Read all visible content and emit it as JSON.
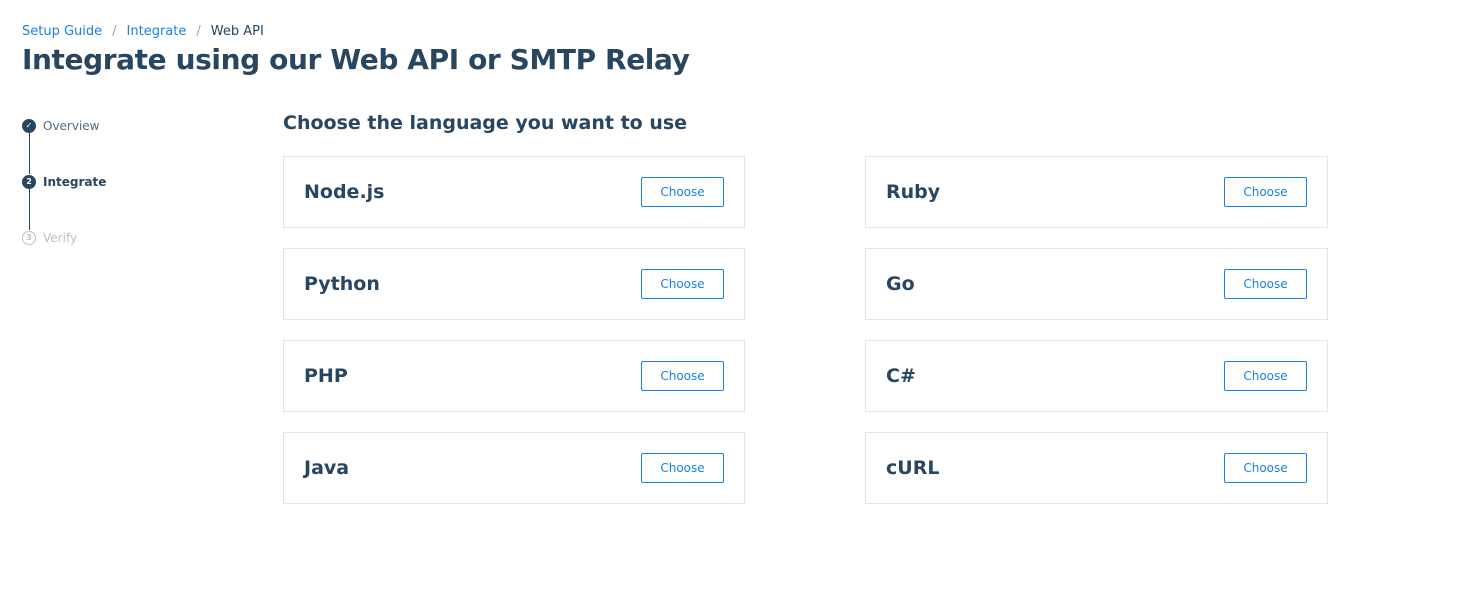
{
  "breadcrumb": {
    "items": [
      "Setup Guide",
      "Integrate"
    ],
    "current": "Web API",
    "separator": "/"
  },
  "page_title": "Integrate using our Web API or SMTP Relay",
  "stepper": {
    "steps": [
      {
        "marker": "✓",
        "label": "Overview",
        "state": "completed"
      },
      {
        "marker": "2",
        "label": "Integrate",
        "state": "active"
      },
      {
        "marker": "3",
        "label": "Verify",
        "state": "pending"
      }
    ]
  },
  "section_title": "Choose the language you want to use",
  "languages": [
    {
      "name": "Node.js",
      "button": "Choose"
    },
    {
      "name": "Ruby",
      "button": "Choose"
    },
    {
      "name": "Python",
      "button": "Choose"
    },
    {
      "name": "Go",
      "button": "Choose"
    },
    {
      "name": "PHP",
      "button": "Choose"
    },
    {
      "name": "C#",
      "button": "Choose"
    },
    {
      "name": "Java",
      "button": "Choose"
    },
    {
      "name": "cURL",
      "button": "Choose"
    }
  ],
  "colors": {
    "heading": "#294661",
    "link": "#1a82e2",
    "border": "#e3e6e9",
    "muted": "#b8c0c8"
  }
}
